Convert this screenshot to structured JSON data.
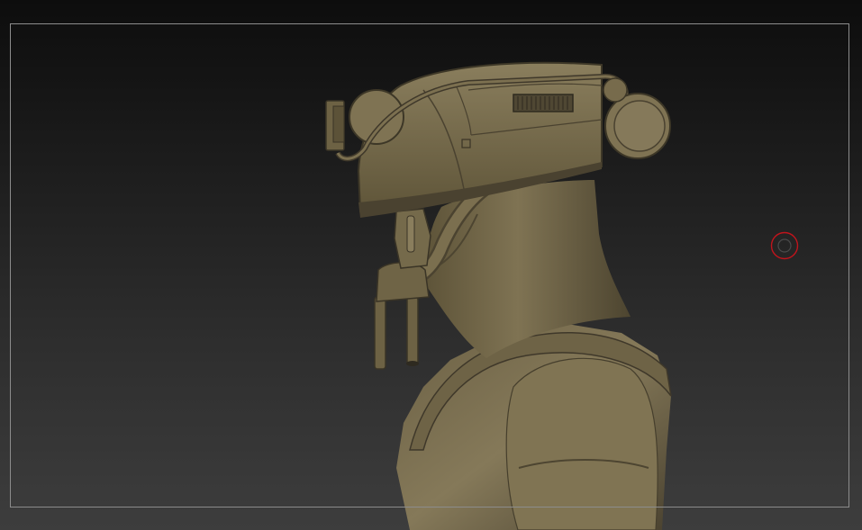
{
  "viewport": {
    "background_top": "#0d0d0d",
    "background_bottom": "#3d3d3d",
    "frame_color": "#8c8c8c"
  },
  "model": {
    "material_color": "#7a6f4f",
    "icon": "sculpt-mesh"
  },
  "cursor": {
    "icon": "brush-circle-icon",
    "color": "#c0141c"
  }
}
